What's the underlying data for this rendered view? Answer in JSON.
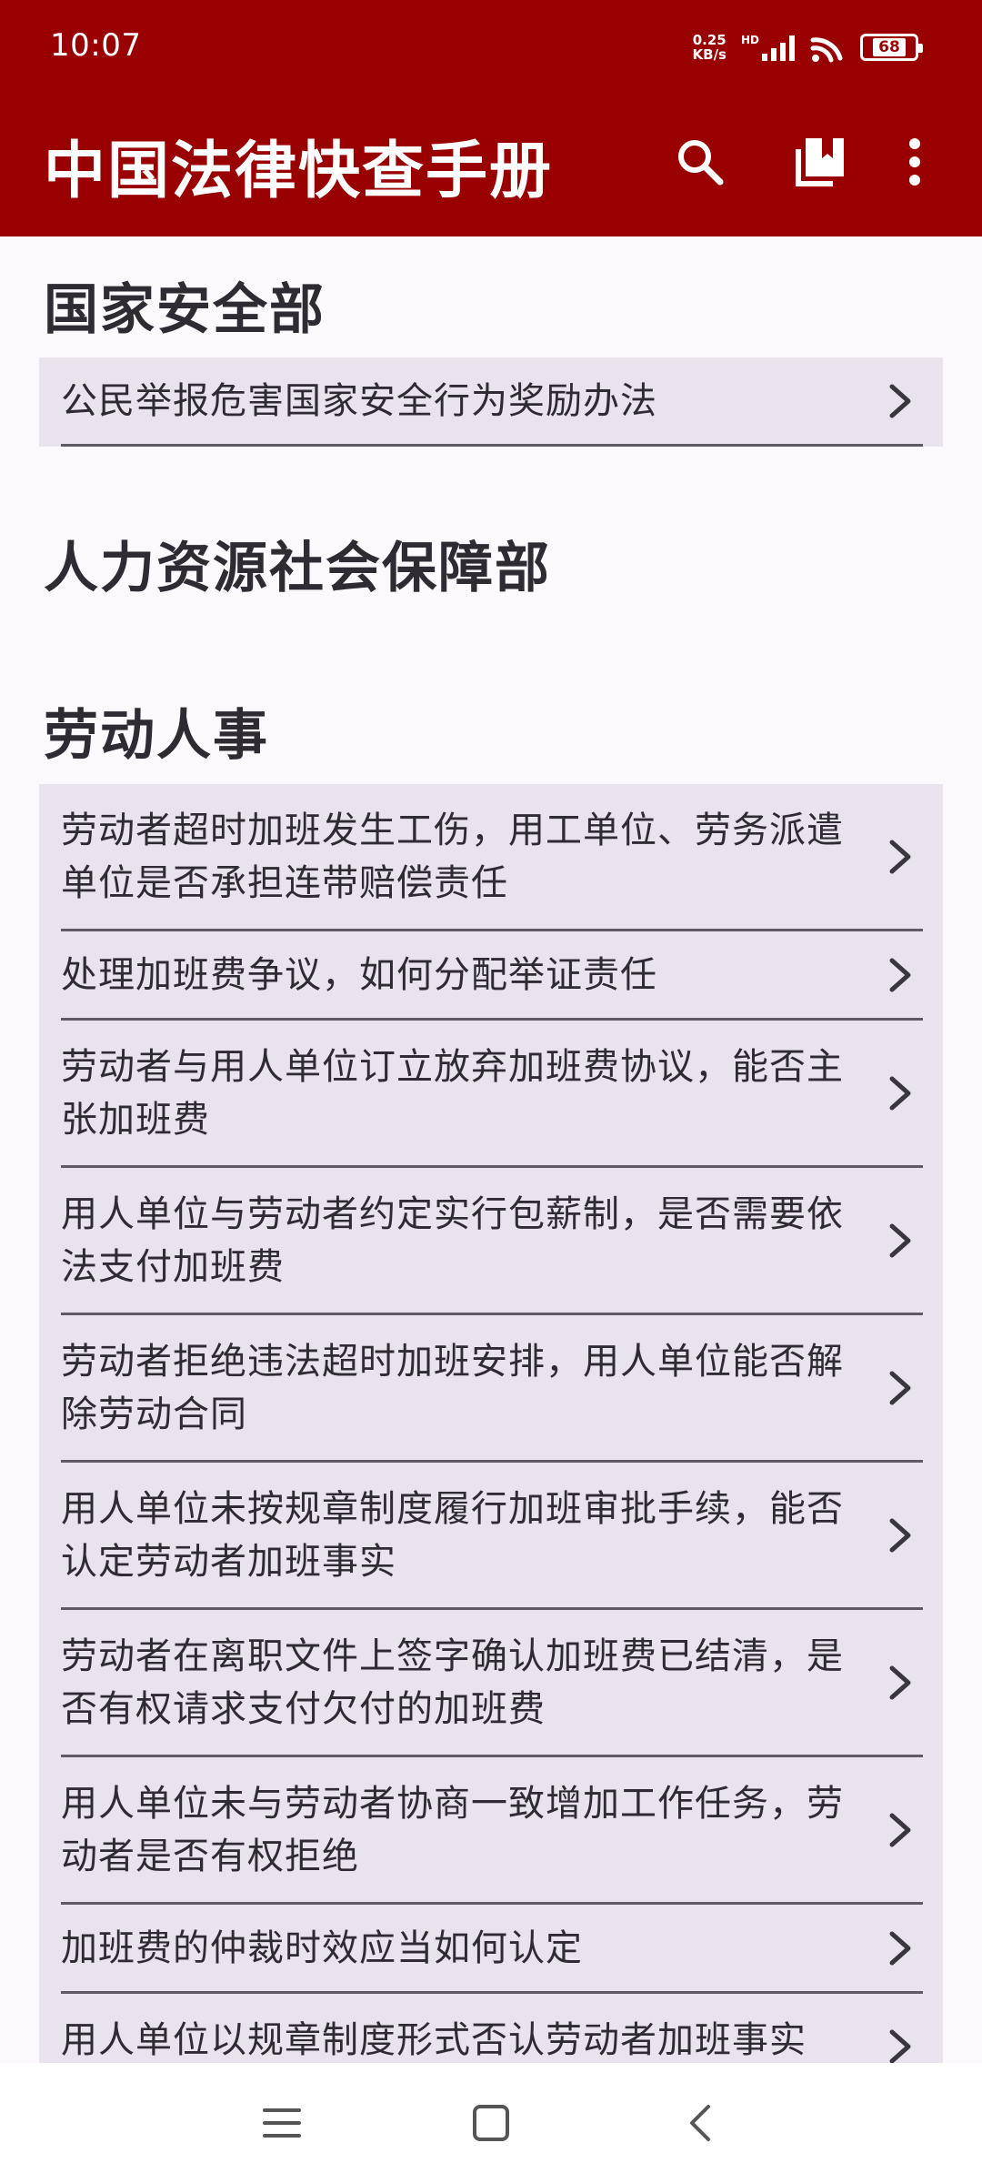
{
  "status": {
    "time": "10:07",
    "net_speed_value": "0.25",
    "net_speed_unit": "KB/s",
    "hd": "HD",
    "battery": "68"
  },
  "app": {
    "title": "中国法律快查手册",
    "actions": [
      "search-icon",
      "bookmarks-icon",
      "more-vert-icon"
    ]
  },
  "sections": [
    {
      "title": "国家安全部",
      "items": [
        "公民举报危害国家安全行为奖励办法"
      ]
    },
    {
      "title": "人力资源社会保障部",
      "items": []
    },
    {
      "title": "劳动人事",
      "items": [
        "劳动者超时加班发生工伤，用工单位、劳务派遣单位是否承担连带赔偿责任",
        "处理加班费争议，如何分配举证责任",
        "劳动者与用人单位订立放弃加班费协议，能否主张加班费",
        "用人单位与劳动者约定实行包薪制，是否需要依法支付加班费",
        "劳动者拒绝违法超时加班安排，用人单位能否解除劳动合同",
        "用人单位未按规章制度履行加班审批手续，能否认定劳动者加班事实",
        "劳动者在离职文件上签字确认加班费已结清，是否有权请求支付欠付的加班费",
        "用人单位未与劳动者协商一致增加工作任务，劳动者是否有权拒绝",
        "加班费的仲裁时效应当如何认定",
        "用人单位以规章制度形式否认劳动者加班事实"
      ]
    }
  ],
  "nav": [
    "menu-icon",
    "home-icon",
    "back-icon"
  ]
}
